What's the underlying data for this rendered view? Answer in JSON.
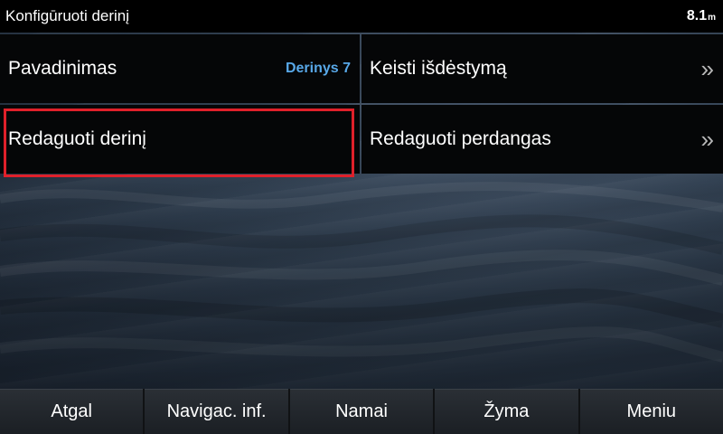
{
  "header": {
    "title": "Konfigūruoti derinį",
    "depth_value": "8.1",
    "depth_unit": "m"
  },
  "menu": {
    "items": [
      {
        "label": "Pavadinimas",
        "value": "Derinys 7"
      },
      {
        "label": "Keisti išdėstymą",
        "chevron": "»"
      },
      {
        "label": "Redaguoti derinį"
      },
      {
        "label": "Redaguoti perdangas",
        "chevron": "»"
      }
    ],
    "selected_index": 2,
    "value_color": "#58a8e8",
    "selection_color": "#e0202a"
  },
  "softkeys": [
    {
      "label": "Atgal"
    },
    {
      "label": "Navigac. inf."
    },
    {
      "label": "Namai"
    },
    {
      "label": "Žyma"
    },
    {
      "label": "Meniu"
    }
  ]
}
